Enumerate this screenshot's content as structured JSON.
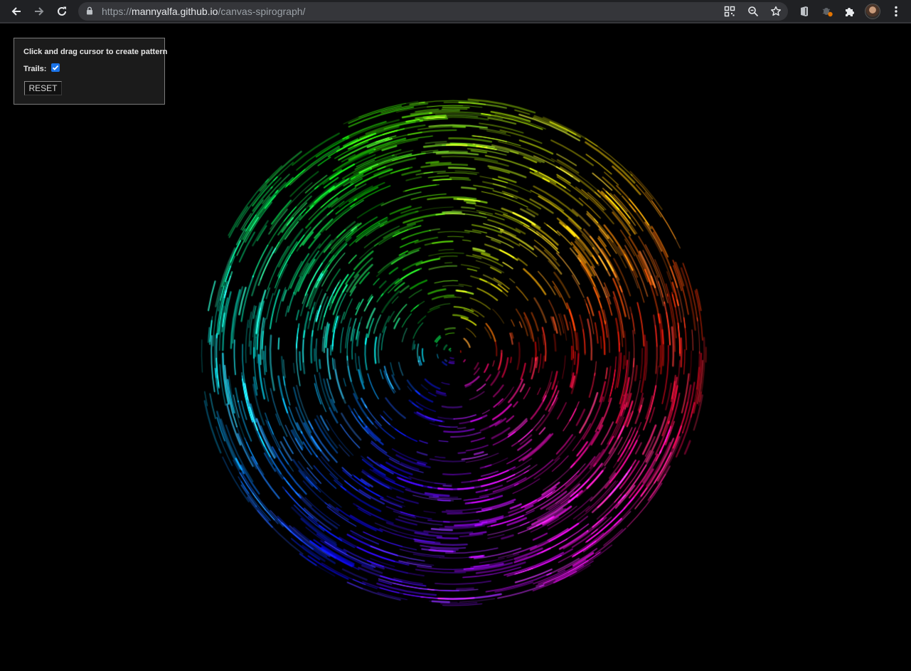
{
  "browser": {
    "url_scheme": "https://",
    "url_host": "mannyalfa.github.io",
    "url_path": "/canvas-spirograph/",
    "icons": {
      "back": "back-arrow-icon",
      "forward": "forward-arrow-icon",
      "reload": "reload-icon",
      "lock": "lock-icon",
      "qr": "qr-code-icon",
      "zoom": "zoom-icon",
      "bookmark": "star-icon",
      "extension_office": "office-extension-icon",
      "extension_bug": "bug-extension-icon",
      "extensions": "puzzle-icon",
      "profile": "avatar",
      "menu": "kebab-menu-icon"
    }
  },
  "controls": {
    "instructions": "Click and drag cursor to create pattern",
    "trails_label": "Trails:",
    "trails_checked": true,
    "reset_label": "RESET"
  },
  "colors": {
    "background": "#000000",
    "panel_background": "#1b1b1b",
    "checkbox_accent": "#1a73e8"
  }
}
